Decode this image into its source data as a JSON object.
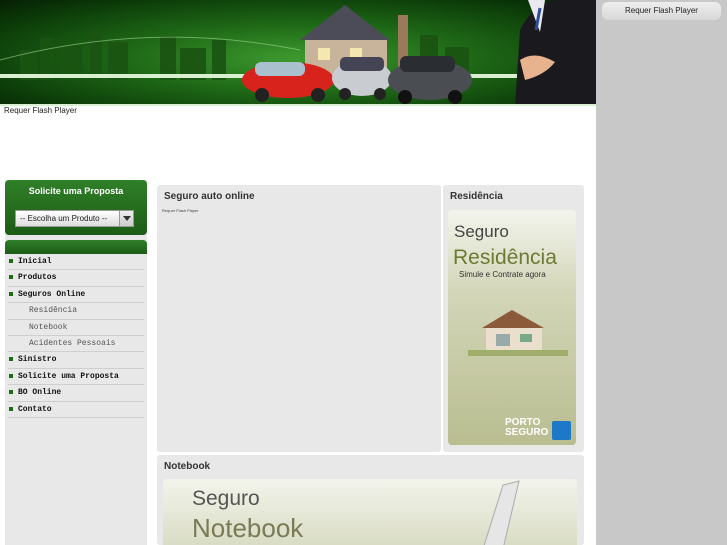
{
  "flash": {
    "banner_notice": "Requer Flash Player",
    "right_notice": "Requer Flash Player",
    "auto_notice": "Requer Flash Player"
  },
  "proposta": {
    "title": "Solicite uma Proposta",
    "select_value": "-- Escolha um Produto --"
  },
  "menu": {
    "items": [
      {
        "label": "Inicial"
      },
      {
        "label": "Produtos"
      },
      {
        "label": "Seguros Online"
      },
      {
        "label": "Residência"
      },
      {
        "label": "Notebook"
      },
      {
        "label": "Acidentes Pessoais"
      },
      {
        "label": "Sinistro"
      },
      {
        "label": "Solicite uma Proposta"
      },
      {
        "label": "BO Online"
      },
      {
        "label": "Contato"
      }
    ]
  },
  "auto": {
    "title": "Seguro auto online"
  },
  "residencia": {
    "title": "Residência",
    "ad_line1": "Seguro",
    "ad_line2": "Residência",
    "ad_line3": "Simule e Contrate agora",
    "logo_line1": "PORTO",
    "logo_line2": "SEGURO"
  },
  "notebook": {
    "title": "Notebook",
    "ad_line1": "Seguro",
    "ad_line2": "Notebook"
  },
  "colors": {
    "brand_green": "#1f6a17",
    "panel_gray": "#e8e8e8",
    "side_gray": "#c8c8c8"
  }
}
